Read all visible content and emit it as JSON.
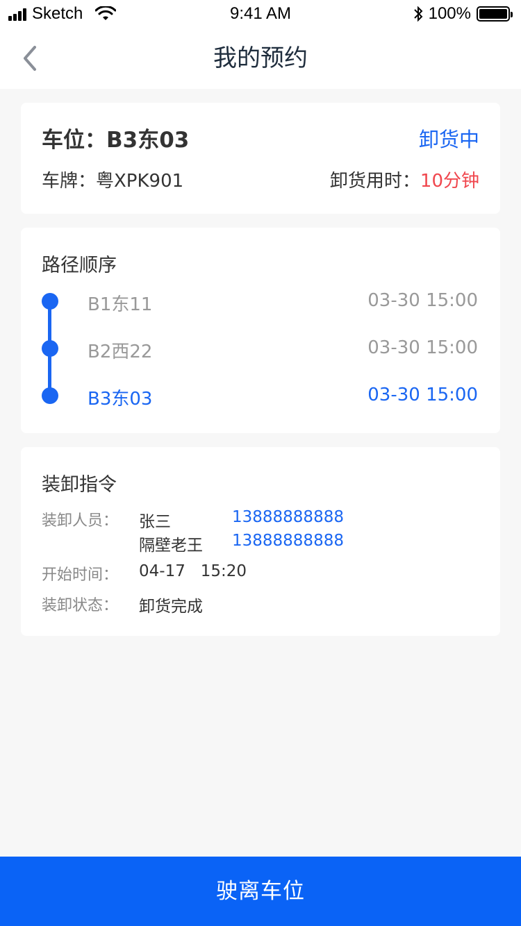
{
  "status_bar": {
    "carrier": "Sketch",
    "time": "9:41 AM",
    "battery": "100%",
    "battery_level": 1.0
  },
  "nav": {
    "title": "我的预约",
    "back_icon": "chevron-left-icon"
  },
  "spot_card": {
    "spot_label": "车位：B3东03",
    "status": "卸货中",
    "plate_label": "车牌：粤XPK901",
    "duration_label": "卸货用时：",
    "duration_value": "10分钟"
  },
  "route": {
    "title": "路径顺序",
    "stops": [
      {
        "name": "B1东11",
        "time": "03-30 15:00",
        "active": false
      },
      {
        "name": "B2西22",
        "time": "03-30 15:00",
        "active": false
      },
      {
        "name": "B3东03",
        "time": "03-30 15:00",
        "active": true
      }
    ]
  },
  "instructions": {
    "title": "装卸指令",
    "staff_label": "装卸人员：",
    "staff": [
      {
        "name": "张三",
        "phone": "13888888888"
      },
      {
        "name": "隔壁老王",
        "phone": "13888888888"
      }
    ],
    "start_label": "开始时间：",
    "start_value": "04-17   15:20",
    "status_label": "装卸状态：",
    "status_value": "卸货完成"
  },
  "action": {
    "leave_label": "驶离车位"
  },
  "colors": {
    "accent": "#1a66f2",
    "button": "#0a63f6",
    "warning": "#f0474e",
    "background": "#f7f7f7"
  }
}
